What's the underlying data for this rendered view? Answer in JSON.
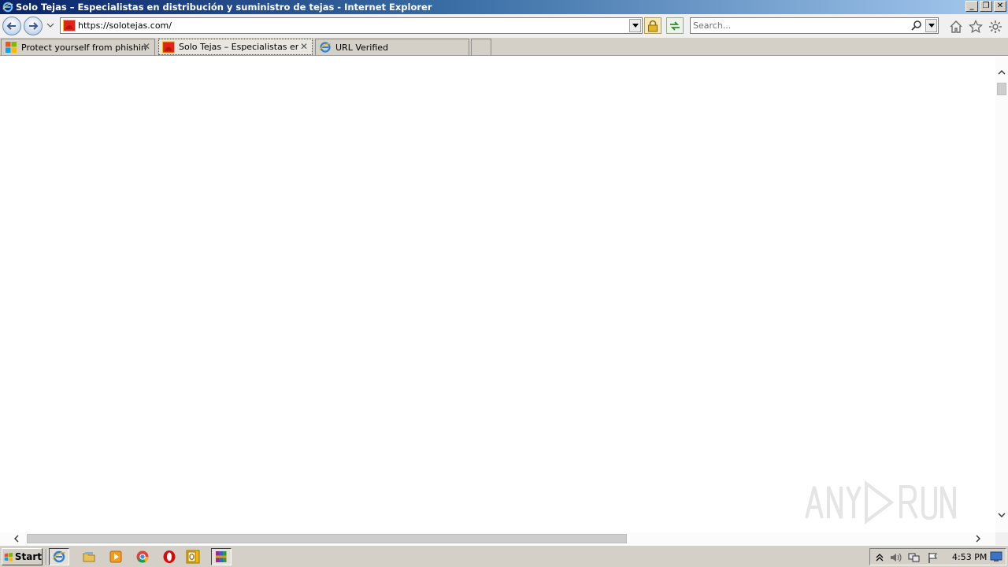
{
  "window": {
    "title": "Solo Tejas – Especialistas en distribución y suministro de tejas - Internet Explorer"
  },
  "navbar": {
    "url": "https://solotejas.com/",
    "search_placeholder": "Search..."
  },
  "tabs": [
    {
      "label": "Protect yourself from phishing",
      "icon": "windows-flag-icon",
      "active": false,
      "closable": true
    },
    {
      "label": "Solo Tejas – Especialistas en...",
      "icon": "solotejas-favicon",
      "active": true,
      "closable": true
    },
    {
      "label": "URL Verified",
      "icon": "ie-logo-icon",
      "active": false,
      "closable": false
    }
  ],
  "taskbar": {
    "start_label": "Start",
    "clock": "4:53 PM",
    "apps": [
      "internet-explorer",
      "file-explorer",
      "media-player",
      "chrome",
      "opera",
      "outlook",
      "winrar"
    ]
  },
  "colors": {
    "title_gradient_start": "#0a246a",
    "title_gradient_end": "#a6caf0",
    "chrome_gray": "#d4d0c8",
    "favicon_red": "#e02418",
    "favicon_yellow": "#f2c200"
  }
}
